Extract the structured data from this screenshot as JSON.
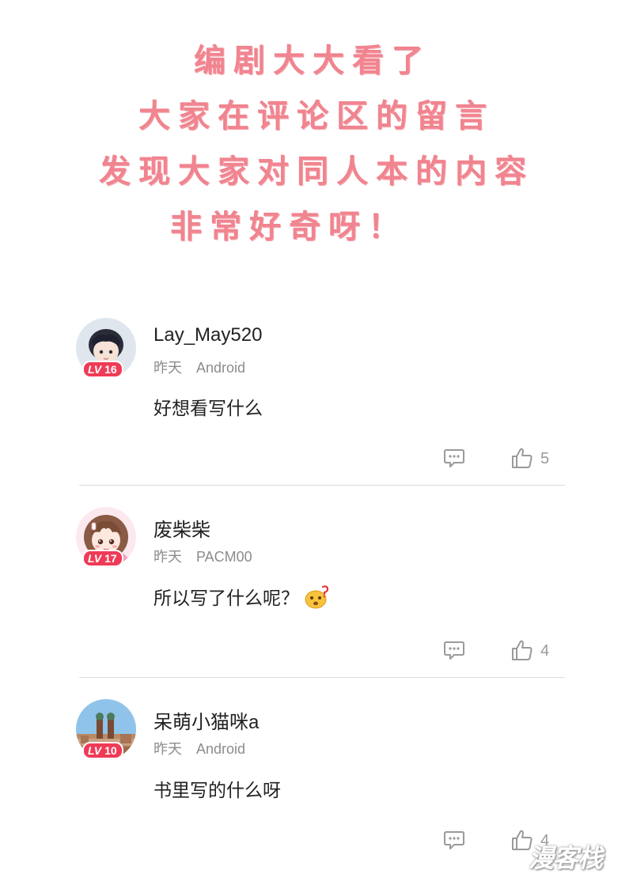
{
  "header": {
    "lines": [
      "编剧大大看了",
      "大家在评论区的留言",
      "发现大家对同人本的内容",
      "非常好奇呀！"
    ]
  },
  "comments": [
    {
      "username": "Lay_May520",
      "level": "16",
      "level_tag": "LV",
      "time": "昨天",
      "device": "Android",
      "text": "好想看写什么",
      "likes": "5",
      "avatar_icon": "boy-avatar-icon"
    },
    {
      "username": "废柴柴",
      "level": "17",
      "level_tag": "LV",
      "time": "昨天",
      "device": "PACM00",
      "text": "所以写了什么呢？",
      "emoji": "confused-face-emoji",
      "likes": "4",
      "avatar_icon": "girl-avatar-icon"
    },
    {
      "username": "呆萌小猫咪a",
      "level": "10",
      "level_tag": "LV",
      "time": "昨天",
      "device": "Android",
      "text": "书里写的什么呀",
      "likes": "4",
      "avatar_icon": "city-avatar-icon"
    }
  ],
  "watermark": {
    "text": "漫客栈"
  },
  "colors": {
    "title_pink": "#f0848f",
    "badge_red": "#ef3b57",
    "meta_gray": "#8c8c8c",
    "divider": "#dcdcdc"
  }
}
